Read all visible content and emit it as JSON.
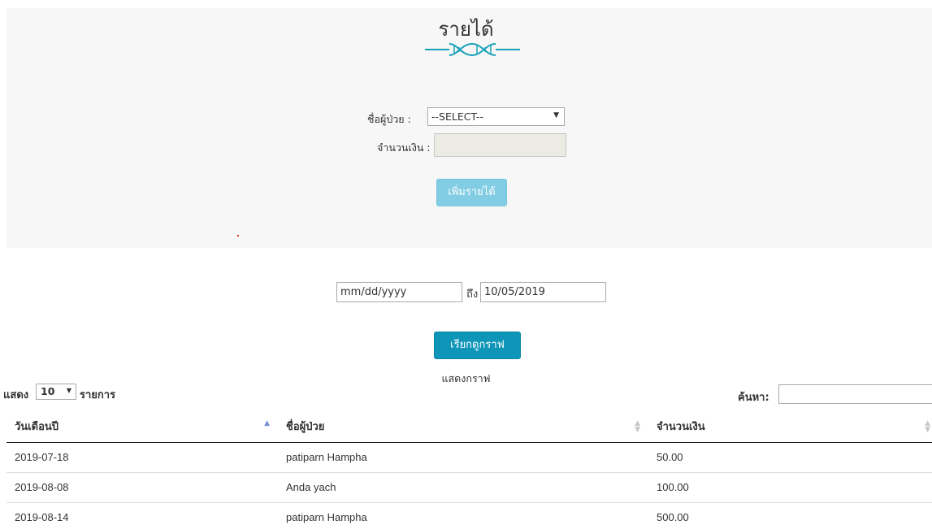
{
  "page": {
    "title": "รายได้"
  },
  "form": {
    "patient_label": "ชื่อผู้ป่วย :",
    "patient_select_value": "--SELECT--",
    "amount_label": "จำนวนเงิน :",
    "amount_value": "",
    "add_button_label": "เพิ่มรายได้"
  },
  "graph_filter": {
    "date_from_placeholder": "mm/dd/yyyy",
    "to_label": "ถึง",
    "date_to_value": "10/05/2019",
    "graph_button_label": "เรียกดูกราฟ",
    "graph_caption": "แสดงกราฟ"
  },
  "table_controls": {
    "show_label": "แสดง",
    "page_length": "10",
    "items_label": "รายการ",
    "search_label": "ค้นหา:"
  },
  "table": {
    "headers": [
      "วันเดือนปี",
      "ชื่อผู้ป่วย",
      "จำนวนเงิน"
    ],
    "rows": [
      [
        "2019-07-18",
        "patiparn Hampha",
        "50.00"
      ],
      [
        "2019-08-08",
        "Anda yach",
        "100.00"
      ],
      [
        "2019-08-14",
        "patiparn Hampha",
        "500.00"
      ]
    ]
  },
  "icons": {
    "divider": "dna-icon",
    "sort_asc": "sort-asc-icon",
    "sort_both": "sort-both-icon",
    "dropdown": "chevron-down-icon"
  },
  "colors": {
    "accent": "#0e95b8",
    "add_button": "#5bc0de",
    "divider": "#17a2b8",
    "panel_bg": "#f7f7f7"
  }
}
